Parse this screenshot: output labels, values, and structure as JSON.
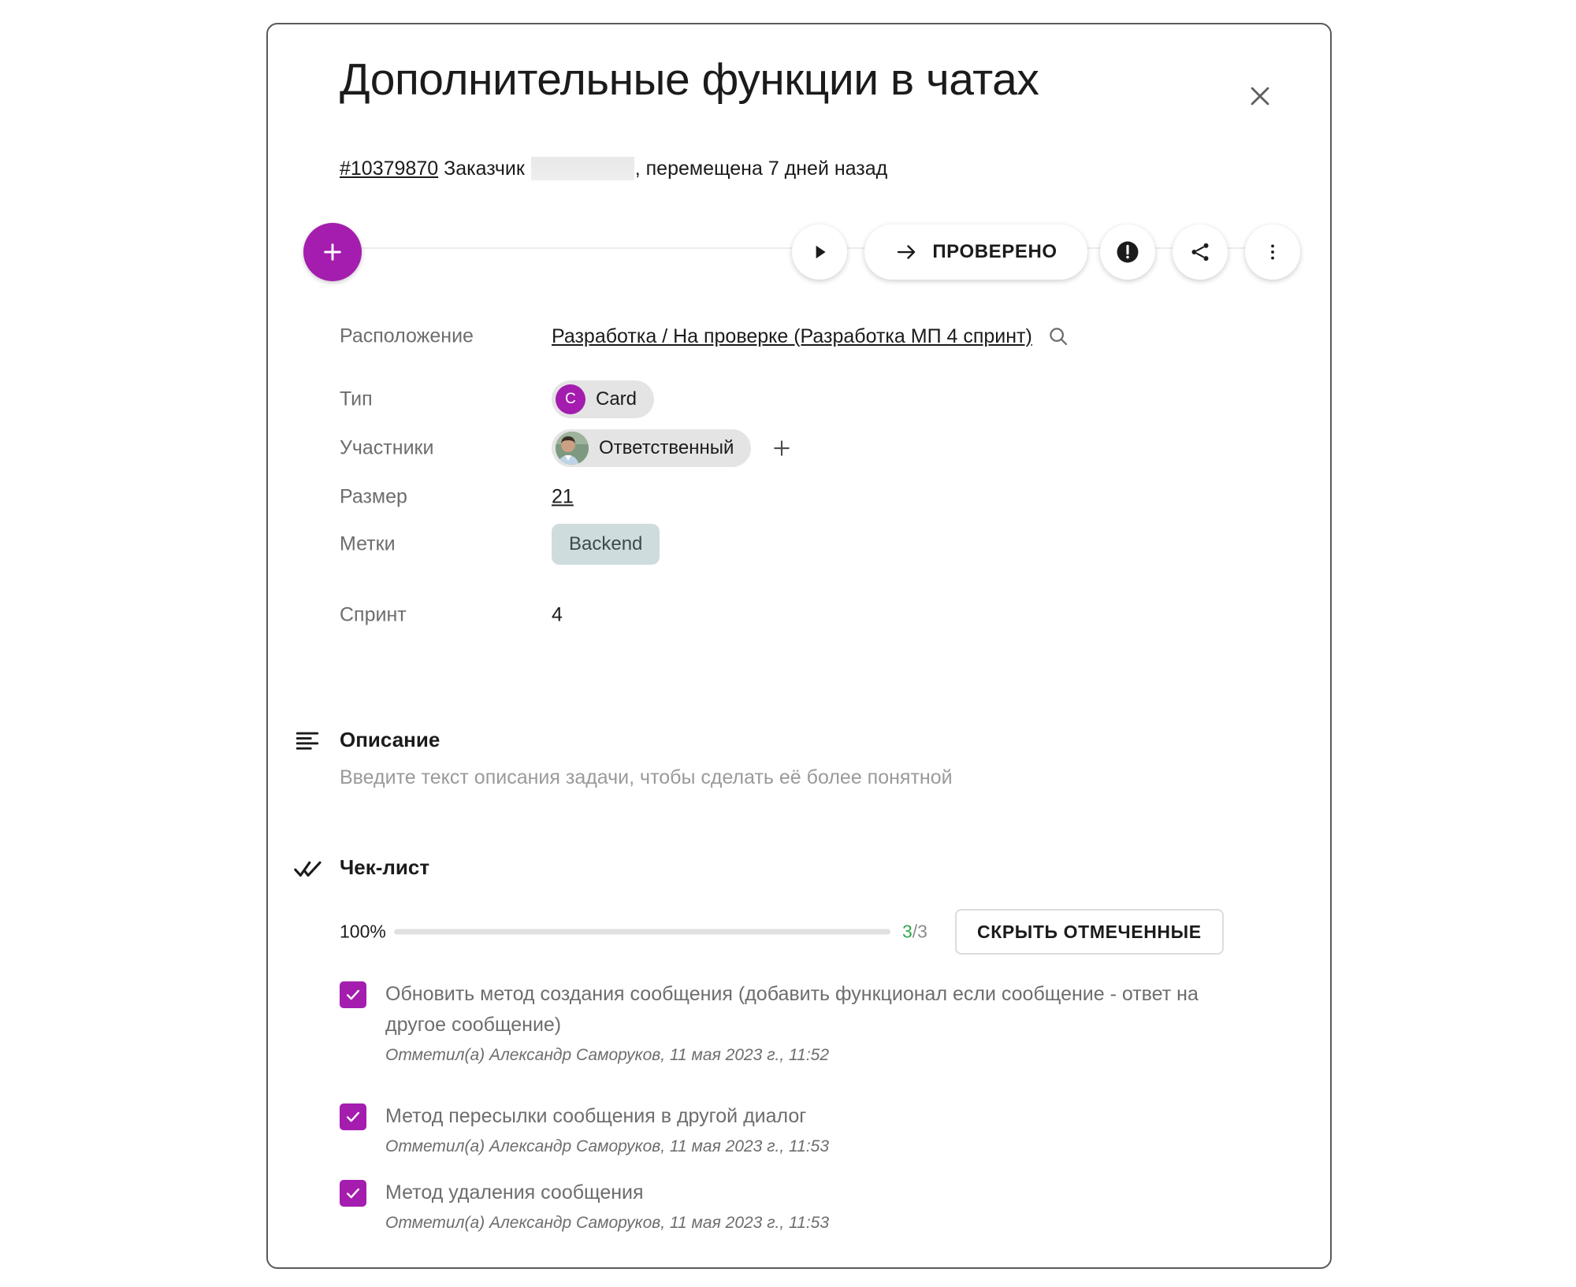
{
  "card": {
    "title": "Дополнительные функции в чатах",
    "close_icon": "close-icon",
    "subtitle": {
      "ticket": "#10379870",
      "customer_label": "Заказчик",
      "redacted": "",
      "moved_text": ", перемещена 7 дней назад"
    }
  },
  "actions": {
    "add_label": "+",
    "play_label": "play-icon",
    "checked_label": "ПРОВЕРЕНО",
    "alert_label": "alert-icon",
    "share_label": "share-icon",
    "more_label": "more-icon"
  },
  "properties": {
    "location": {
      "label": "Расположение",
      "value": "Разработка / На проверке (Разработка МП 4 спринт)"
    },
    "type": {
      "label": "Тип",
      "avatar_letter": "C",
      "value": "Card"
    },
    "members": {
      "label": "Участники",
      "value": "Ответственный",
      "add": "+"
    },
    "size": {
      "label": "Размер",
      "value": "21"
    },
    "labels": {
      "label": "Метки",
      "value": "Backend"
    },
    "sprint": {
      "label": "Спринт",
      "value": "4"
    }
  },
  "description": {
    "heading": "Описание",
    "placeholder": "Введите текст описания задачи, чтобы сделать её более понятной"
  },
  "checklist": {
    "heading": "Чек-лист",
    "percent": "100%",
    "progress_value": 100,
    "done": "3",
    "total": "/3",
    "hide_button": "СКРЫТЬ ОТМЕЧЕННЫЕ",
    "items": [
      {
        "text": "Обновить метод создания сообщения (добавить функционал если сообщение - ответ на другое сообщение)",
        "meta": "Отметил(а) Александр Саморуков, 11 мая 2023 г., 11:52"
      },
      {
        "text": "Метод пересылки сообщения в другой диалог",
        "meta": "Отметил(а) Александр Саморуков, 11 мая 2023 г., 11:53"
      },
      {
        "text": "Метод удаления сообщения",
        "meta": "Отметил(а) Александр Саморуков, 11 мая 2023 г., 11:53"
      }
    ]
  },
  "colors": {
    "accent_purple": "#A41DAF",
    "tag_backend_bg": "#CFDCDE",
    "done_green": "#34A853",
    "muted_text": "#6D6D6D"
  }
}
